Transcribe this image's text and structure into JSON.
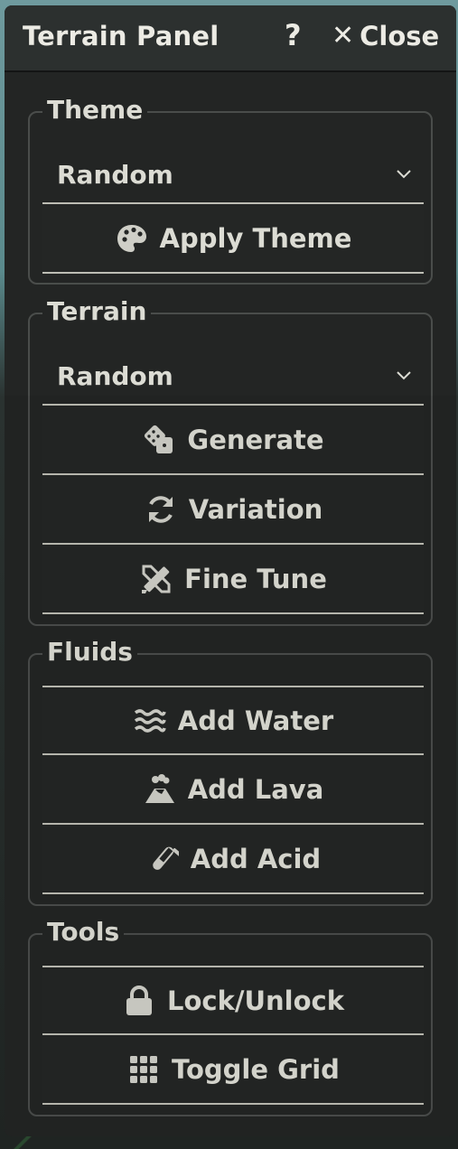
{
  "header": {
    "title": "Terrain Panel",
    "help_label": "?",
    "close_label": "Close"
  },
  "theme": {
    "legend": "Theme",
    "select_value": "Random",
    "apply_label": "Apply Theme",
    "apply_icon": "palette-icon"
  },
  "terrain": {
    "legend": "Terrain",
    "select_value": "Random",
    "buttons": [
      {
        "label": "Generate",
        "icon": "dice-icon"
      },
      {
        "label": "Variation",
        "icon": "refresh-icon"
      },
      {
        "label": "Fine Tune",
        "icon": "pencil-ruler-icon"
      }
    ]
  },
  "fluids": {
    "legend": "Fluids",
    "buttons": [
      {
        "label": "Add Water",
        "icon": "water-icon"
      },
      {
        "label": "Add Lava",
        "icon": "volcano-icon"
      },
      {
        "label": "Add Acid",
        "icon": "vial-icon"
      }
    ]
  },
  "tools": {
    "legend": "Tools",
    "buttons": [
      {
        "label": "Lock/Unlock",
        "icon": "lock-icon"
      },
      {
        "label": "Toggle Grid",
        "icon": "grid-icon"
      }
    ]
  }
}
